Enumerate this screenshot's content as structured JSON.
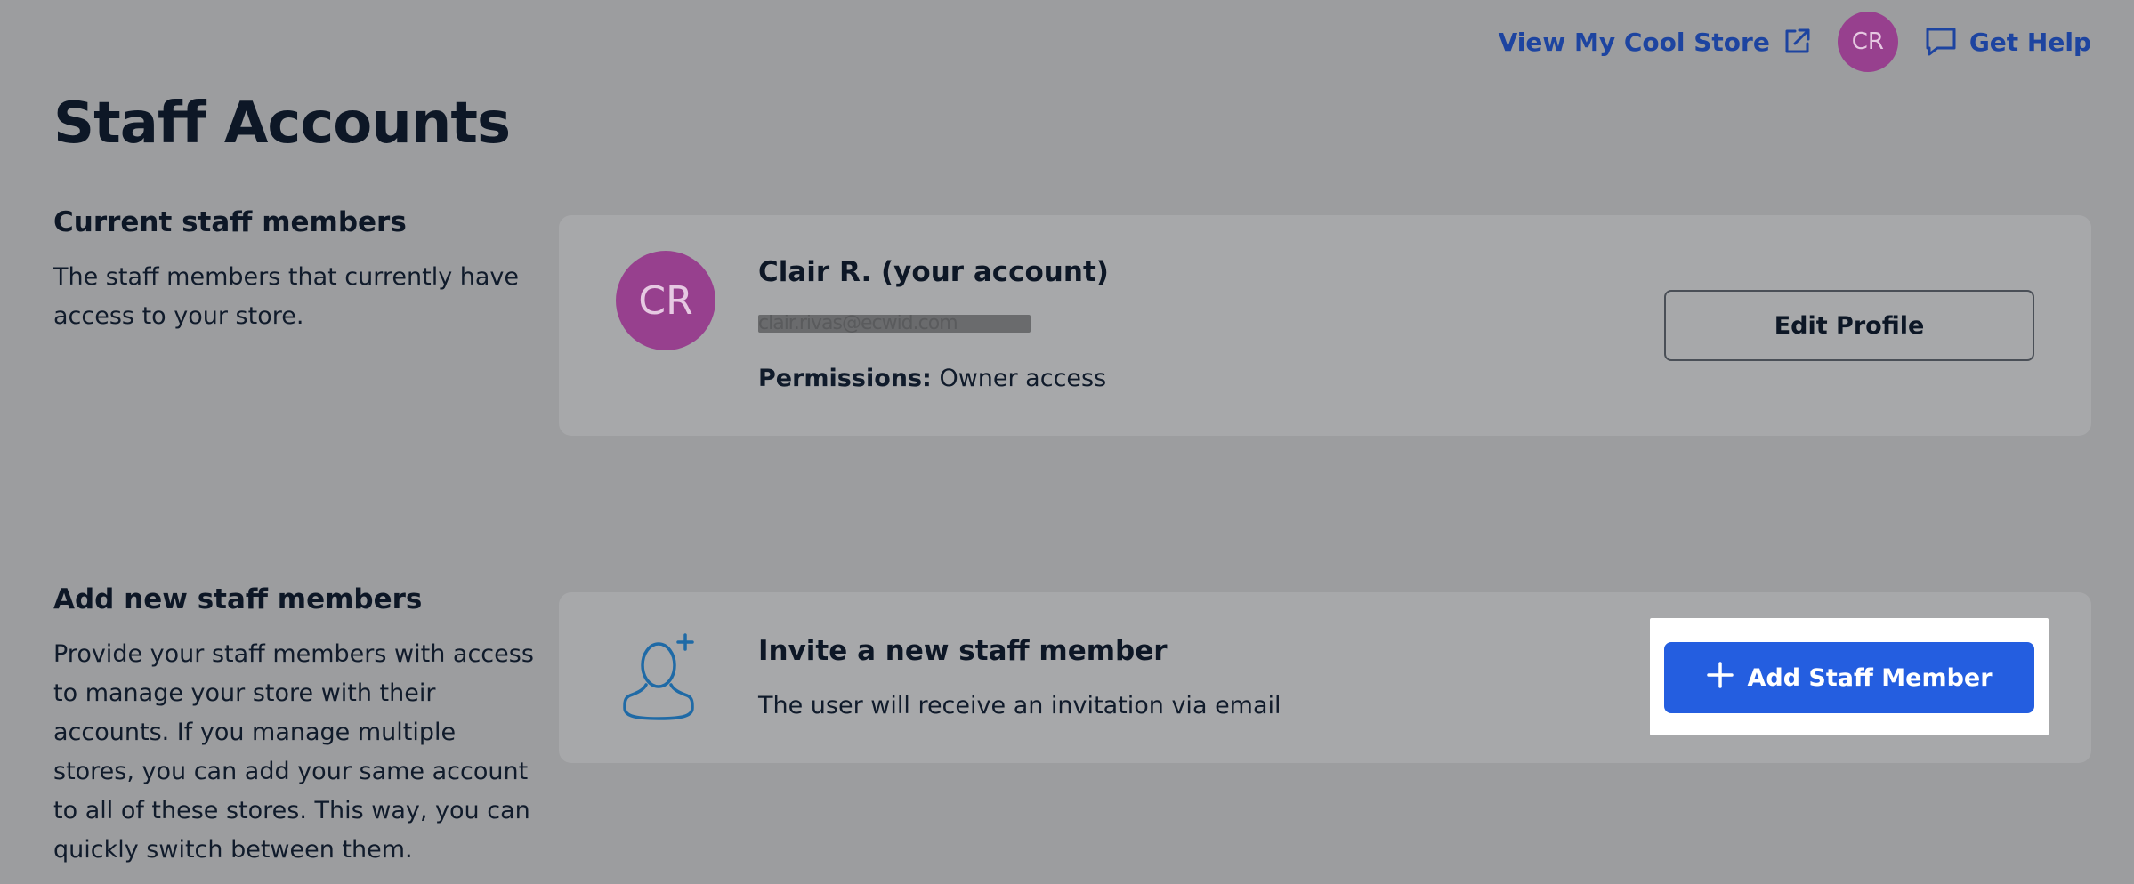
{
  "header": {
    "store_link": "View My Cool Store",
    "avatar_initials": "CR",
    "help_link": "Get Help"
  },
  "page_title": "Staff Accounts",
  "current_staff": {
    "heading": "Current staff members",
    "description": "The staff members that currently have access to your store.",
    "member": {
      "initials": "CR",
      "name": "Clair R. (your account)",
      "email": "clair.rivas@ecwid.com",
      "permissions_label": "Permissions:",
      "permissions_value": "Owner access"
    },
    "edit_button": "Edit Profile"
  },
  "add_staff": {
    "heading": "Add new staff members",
    "description": "Provide your staff members with access to manage your store with their accounts. If you manage multiple stores, you can add your same account to all of these stores. This way, you can quickly switch between them.",
    "invite_title": "Invite a new staff member",
    "invite_subtitle": "The user will receive an invitation via email",
    "add_button": "Add Staff Member"
  },
  "colors": {
    "accent": "#245ee0",
    "link": "#1d44a0",
    "avatar": "#97408e"
  },
  "icons": {
    "external": "external-link-icon",
    "chat": "chat-icon",
    "invite": "add-user-icon",
    "plus": "plus-icon"
  }
}
